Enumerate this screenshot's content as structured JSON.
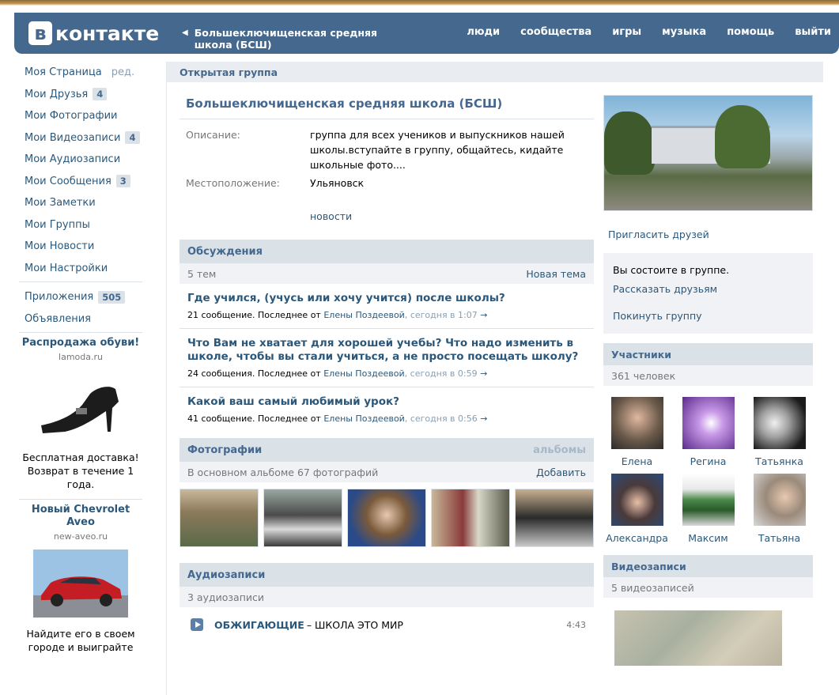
{
  "header": {
    "logo_letter": "в",
    "logo_text": "контакте",
    "back_link": "Большеключищенская средняя школа (БСШ)",
    "nav": [
      "люди",
      "сообщества",
      "игры",
      "музыка",
      "помощь",
      "выйти"
    ]
  },
  "sidebar": {
    "items": [
      {
        "label": "Моя Страница",
        "extra": "ред."
      },
      {
        "label": "Мои Друзья",
        "badge": "4"
      },
      {
        "label": "Мои Фотографии"
      },
      {
        "label": "Мои Видеозаписи",
        "badge": "4"
      },
      {
        "label": "Мои Аудиозаписи"
      },
      {
        "label": "Мои Сообщения",
        "badge": "3"
      },
      {
        "label": "Мои Заметки"
      },
      {
        "label": "Мои Группы"
      },
      {
        "label": "Мои Новости"
      },
      {
        "label": "Мои Настройки"
      }
    ],
    "items2": [
      {
        "label": "Приложения",
        "badge": "505"
      },
      {
        "label": "Объявления"
      }
    ],
    "ads": [
      {
        "title": "Распродажа обуви!",
        "domain": "lamoda.ru",
        "text": "Бесплатная доставка! Возврат в течение 1 года."
      },
      {
        "title": "Новый Chevrolet Aveo",
        "domain": "new-aveo.ru",
        "text": "Найдите его в своем городе и выиграйте"
      }
    ]
  },
  "main": {
    "head": "Открытая группа",
    "group_title": "Большеключищенская средняя школа (БСШ)",
    "description_label": "Описание:",
    "description": "группа для всех учеников и выпускников нашей школы.вступайте в группу, общайтесь, кидайте школьные фото....",
    "location_label": "Местоположение:",
    "location": "Ульяновск",
    "news_link": "новости"
  },
  "discussions": {
    "title": "Обсуждения",
    "count": "5 тем",
    "new_topic": "Новая тема",
    "topics": [
      {
        "title": "Где учился, (учусь или хочу учится) после школы?",
        "meta": "21 сообщение. Последнее от",
        "author": "Елены Поздеевой",
        "time": ", сегодня в 1:07",
        "arrow": "→"
      },
      {
        "title": "Что Вам не хватает для хорошей учебы? Что надо изменить в школе, чтобы вы стали учиться, а не просто посещать школу?",
        "meta": "24 сообщения. Последнее от",
        "author": "Елены Поздеевой",
        "time": ", сегодня в 0:59",
        "arrow": "→"
      },
      {
        "title": "Какой ваш самый любимый урок?",
        "meta": "41 сообщение. Последнее от",
        "author": "Елены Поздеевой",
        "time": ", сегодня в 0:56",
        "arrow": "→"
      }
    ]
  },
  "photos": {
    "title": "Фотографии",
    "albums": "альбомы",
    "count": "В основном альбоме 67 фотографий",
    "add": "Добавить"
  },
  "audio": {
    "title": "Аудиозаписи",
    "count": "3 аудиозаписи",
    "tracks": [
      {
        "artist": "ОБЖИГАЮЩИЕ",
        "title": "– ШКОЛА ЭТО МИР",
        "duration": "4:43"
      }
    ]
  },
  "right": {
    "invite": "Пригласить друзей",
    "member_status": "Вы состоите в группе.",
    "tell_friends": "Рассказать друзьям",
    "leave": "Покинуть группу",
    "members_title": "Участники",
    "members_count": "361 человек",
    "members": [
      {
        "name": "Елена",
        "color": "#6b5a4a"
      },
      {
        "name": "Регина",
        "color": "#8a5ab8"
      },
      {
        "name": "Татьянка",
        "color": "#3a3a3a"
      },
      {
        "name": "Александра",
        "color": "#4a5a6a"
      },
      {
        "name": "Максим",
        "color": "#5a8a5a"
      },
      {
        "name": "Татьяна",
        "color": "#8a7a6a"
      }
    ],
    "videos_title": "Видеозаписи",
    "videos_count": "5 видеозаписей"
  }
}
